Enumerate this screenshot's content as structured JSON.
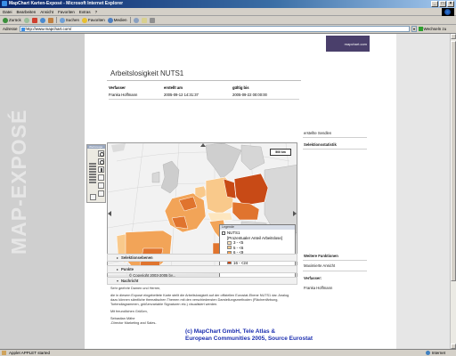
{
  "window": {
    "title": "MapChart Karten-Exposé - Microsoft Internet Explorer",
    "buttons": [
      "_",
      "□",
      "×"
    ]
  },
  "menu": [
    "Datei",
    "Bearbeiten",
    "Ansicht",
    "Favoriten",
    "Extras",
    "?"
  ],
  "toolbar": {
    "back": "Zurück",
    "search": "Suchen",
    "favorites": "Favoriten",
    "media": "Medien"
  },
  "address": {
    "label": "Adresse",
    "url": "http://www.mapchart.com/",
    "go": "Wechseln zu"
  },
  "status": {
    "text": "Applet APPLET started",
    "zone": "Internet"
  },
  "brand": {
    "vertical": "MAP-EXPOSÉ",
    "logo": "mapchart.com"
  },
  "page": {
    "title": "Arbeitslosigkeit NUTS1",
    "meta": {
      "headers": [
        "Verfasser",
        "erstellt am",
        "gültig bis"
      ],
      "values": [
        "Franka Hoffmann",
        "2005-09-12 14:31:37",
        "2005-09-22 00:00:00"
      ]
    }
  },
  "map": {
    "scale": "500 km",
    "copyright": "© Copyright 2003-2005 by...",
    "tools_header": "Werkzeuge",
    "legend": {
      "header": "Legende",
      "layer": "NUTS1",
      "subtitle": "[Prozentualer Anteil Arbeitslose]",
      "items": [
        {
          "label": "3 - <5",
          "color": "#fde6bf"
        },
        {
          "label": "5 - <6",
          "color": "#f9c98b"
        },
        {
          "label": "6 - <9",
          "color": "#f2a458"
        },
        {
          "label": "9 - <16",
          "color": "#e0742e"
        },
        {
          "label": "16 - <24",
          "color": "#c84a16"
        }
      ]
    }
  },
  "sidebar": {
    "saved": "erstellte Sendlen",
    "stats": "Selektionsstatistik",
    "more": "Weitere Funktionen",
    "max_view": "Maximierte Ansicht",
    "author_label": "Verfasser:",
    "author": "Franka Hoffmann"
  },
  "sections": {
    "selection": "Selektionsebenen",
    "points": "Punkte",
    "message": "Nachricht"
  },
  "letter": {
    "greeting": "Sehr geehrte Damen und Herren,",
    "body": "die in diesem Exposé eingebettete Karte stellt die Arbeitslosigkeit auf der offiziellen Eurostat-Ebene NUTS1 dar. Analog dazu können sämtliche thematischen Themen mit den verschiedensten Darstellungsmethoden (Flächenfärbung, Tortendiagrammen, größenvariable Signaturen etc.) visualisiert werden.",
    "closing": "Mit freundlichen Grüßen,",
    "signature1": "Sebastian Mähe",
    "signature2": "-Director Marketing and Sales-"
  },
  "footer": {
    "line1": "(c) MapChart GmbH, Tele Atlas &",
    "line2": "European Communities 2005, Source Eurostat"
  }
}
